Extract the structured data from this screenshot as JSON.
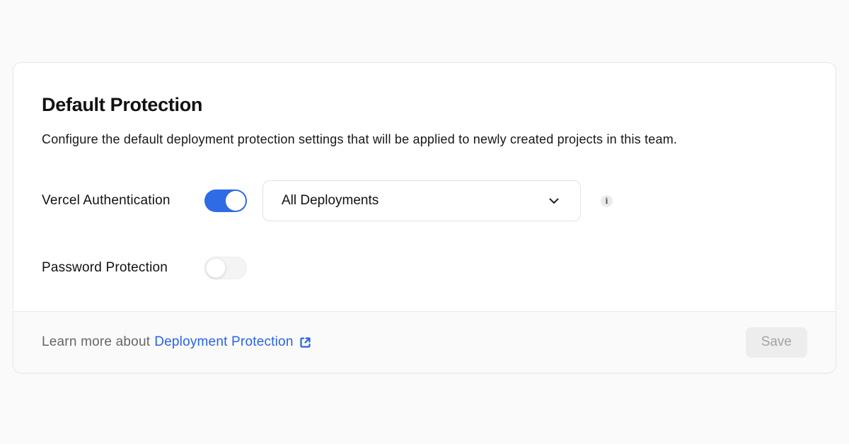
{
  "card": {
    "title": "Default Protection",
    "description": "Configure the default deployment protection settings that will be applied to newly created projects in this team.",
    "rows": [
      {
        "label": "Vercel Authentication",
        "toggle": "on",
        "dropdown": {
          "value": "All Deployments",
          "icon": "chevron-down"
        },
        "info_icon": "info"
      },
      {
        "label": "Password Protection",
        "toggle": "off"
      }
    ],
    "footer": {
      "text_prefix": "Learn more about",
      "link_label": "Deployment Protection",
      "link_icon": "external-link",
      "save_label": "Save"
    }
  },
  "icons": {
    "info_glyph": "i"
  },
  "colors": {
    "page_background": "#fafafa",
    "card_background": "#ffffff",
    "card_border": "#e8e8e8",
    "toggle_on": "#2f6be4",
    "toggle_off_track": "#f4f4f4",
    "link_blue": "#2563eb",
    "footer_background": "#fafafa",
    "save_background": "#ededed",
    "save_text": "#a3a3a3",
    "title_text": "#111111",
    "muted_text": "#666666"
  }
}
